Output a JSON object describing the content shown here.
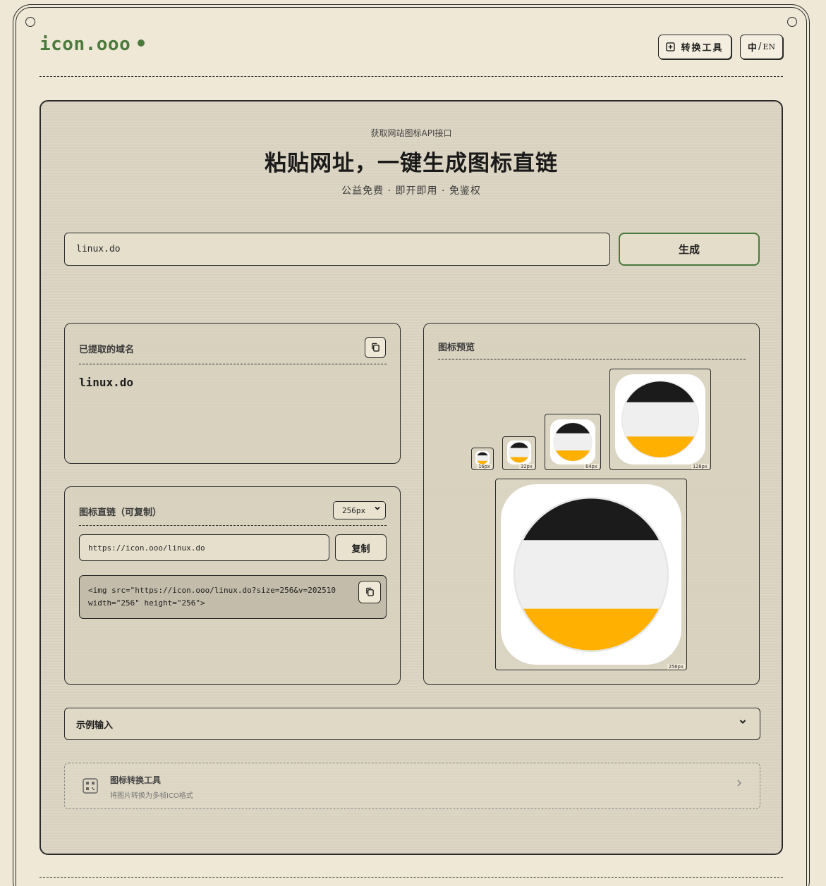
{
  "header": {
    "logo": "icon.ooo",
    "convert_tool_label": "转换工具",
    "lang_zh": "中",
    "lang_sep": "/",
    "lang_en": "EN"
  },
  "hero": {
    "eyebrow": "获取网站图标API接口",
    "headline": "粘贴网址，一键生成图标直链",
    "tagline": "公益免费 · 即开即用 · 免鉴权"
  },
  "search": {
    "value": "linux.do",
    "generate_label": "生成"
  },
  "domain_panel": {
    "title": "已提取的域名",
    "domain": "linux.do"
  },
  "link_panel": {
    "title": "图标直链（可复制）",
    "size_selected": "256px",
    "url": "https://icon.ooo/linux.do",
    "copy_label": "复制",
    "code_line1": "<img src=\"https://icon.ooo/linux.do?size=256&v=202510",
    "code_line2": "width=\"256\" height=\"256\">"
  },
  "preview_panel": {
    "title": "图标预览",
    "sizes": [
      "16px",
      "32px",
      "64px",
      "128px",
      "256px"
    ]
  },
  "examples": {
    "title": "示例输入"
  },
  "tool_card": {
    "title": "图标转换工具",
    "subtitle": "将图片转换为多帧ICO格式"
  },
  "colors": {
    "accent_green": "#4a7a3c",
    "background": "#efe8d6",
    "icon_black": "#1b1b1b",
    "icon_gray": "#efefef",
    "icon_orange": "#ffb000"
  }
}
